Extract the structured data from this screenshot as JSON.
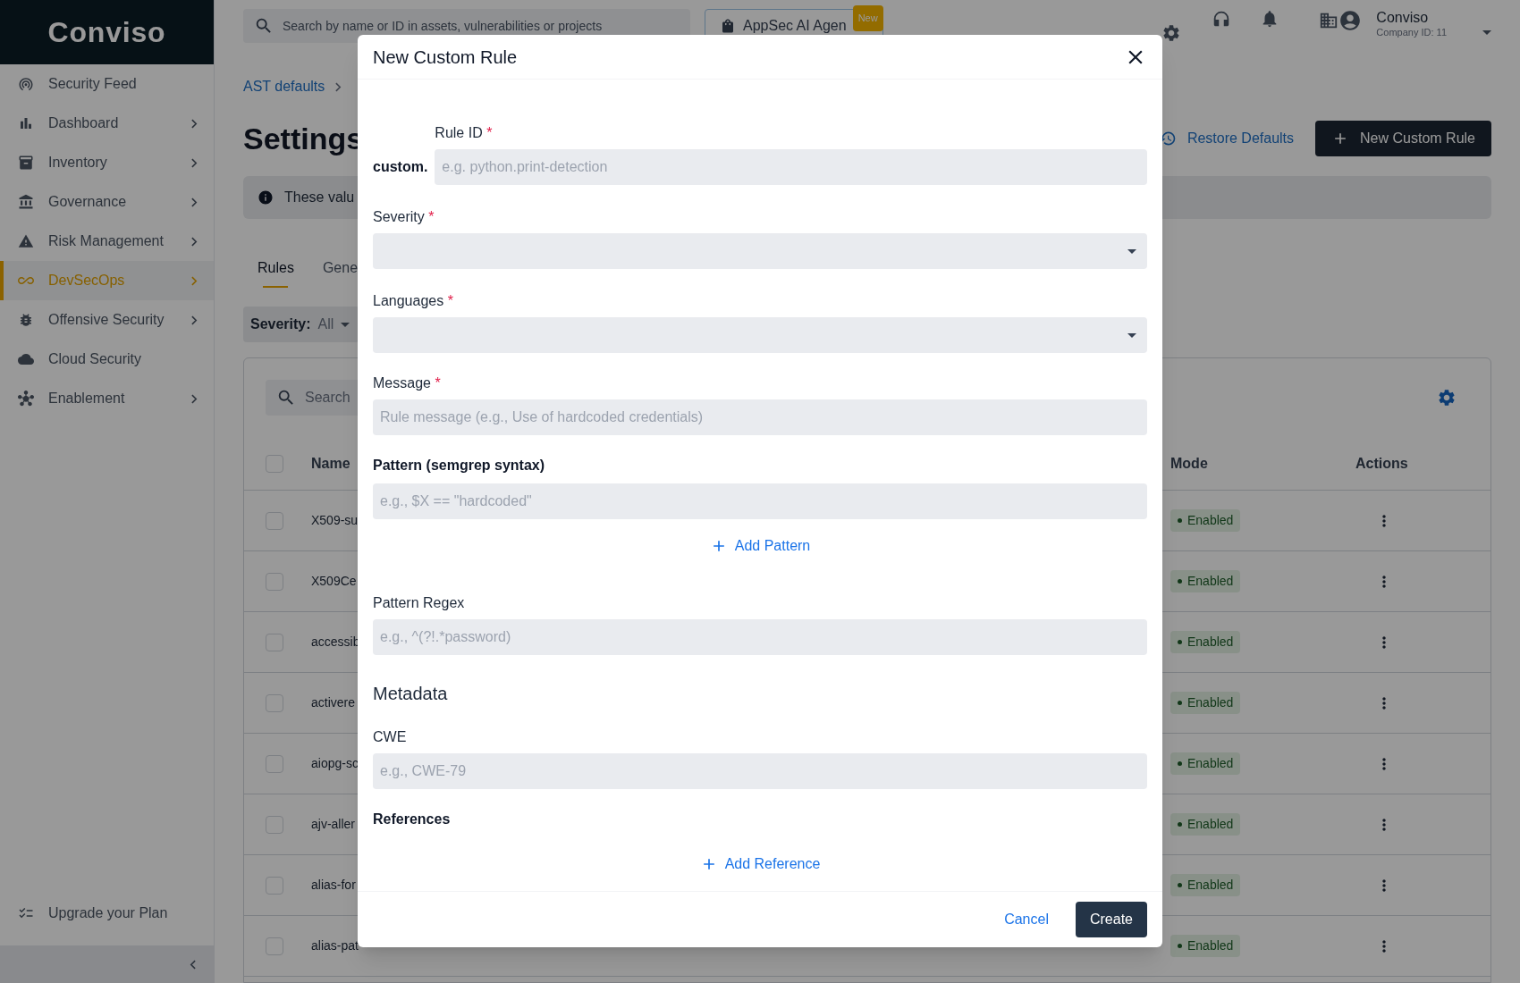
{
  "sidebar": {
    "logo": "Conviso",
    "items": [
      {
        "label": "Security Feed",
        "has_children": false,
        "selected": false
      },
      {
        "label": "Dashboard",
        "has_children": true,
        "selected": false
      },
      {
        "label": "Inventory",
        "has_children": true,
        "selected": false
      },
      {
        "label": "Governance",
        "has_children": true,
        "selected": false
      },
      {
        "label": "Risk Management",
        "has_children": true,
        "selected": false
      },
      {
        "label": "DevSecOps",
        "has_children": true,
        "selected": true
      },
      {
        "label": "Offensive Security",
        "has_children": true,
        "selected": false
      },
      {
        "label": "Cloud Security",
        "has_children": false,
        "selected": false
      },
      {
        "label": "Enablement",
        "has_children": true,
        "selected": false
      }
    ],
    "footer": "Upgrade your Plan"
  },
  "topbar": {
    "search_placeholder": "Search by name or ID in assets, vulnerabilities or projects",
    "agent_button": "AppSec AI Agen",
    "agent_badge": "New",
    "user_name": "Conviso",
    "company": "Company ID: 11"
  },
  "breadcrumb": "AST defaults",
  "page": {
    "title": "Settings",
    "restore": "Restore Defaults",
    "new_rule": "New Custom Rule",
    "banner": "These valu"
  },
  "tabs": [
    {
      "label": "Rules",
      "selected": true
    },
    {
      "label": "Gene",
      "selected": false
    }
  ],
  "filter": {
    "label": "Severity:",
    "value": "All"
  },
  "table": {
    "search_placeholder": "Search",
    "all_checked": false,
    "columns": [
      "Name",
      "Mode",
      "Actions"
    ],
    "rows": [
      {
        "name": "X509-su",
        "mode": "Enabled",
        "checked": false
      },
      {
        "name": "X509Ce",
        "mode": "Enabled",
        "checked": false
      },
      {
        "name": "accessib",
        "mode": "Enabled",
        "checked": false
      },
      {
        "name": "activere",
        "mode": "Enabled",
        "checked": false
      },
      {
        "name": "aiopg-sc",
        "mode": "Enabled",
        "checked": false
      },
      {
        "name": "ajv-aller",
        "mode": "Enabled",
        "checked": false
      },
      {
        "name": "alias-for",
        "mode": "Enabled",
        "checked": false
      },
      {
        "name": "alias-pat",
        "mode": "Enabled",
        "checked": false
      }
    ]
  },
  "modal": {
    "title": "New Custom Rule",
    "items": [
      {
        "kind": "prefixed",
        "prefix": "custom.",
        "label": "Rule ID",
        "mark": "*",
        "placeholder": "e.g. python.print-detection"
      },
      {
        "kind": "select",
        "label": "Severity",
        "mark": "*"
      },
      {
        "kind": "select",
        "label": "Languages",
        "mark": "*"
      },
      {
        "kind": "text",
        "label": "Message",
        "mark": "*",
        "placeholder": "Rule message (e.g., Use of hardcoded credentials)"
      },
      {
        "kind": "heading",
        "label": "Pattern (semgrep syntax)"
      },
      {
        "kind": "input",
        "placeholder": "e.g., $X == \"hardcoded\""
      },
      {
        "kind": "add",
        "label": "Add Pattern"
      },
      {
        "kind": "text",
        "label": "Pattern Regex",
        "placeholder": "e.g., ^(?!.*password)"
      },
      {
        "kind": "section",
        "label": "Metadata"
      },
      {
        "kind": "text",
        "label": "CWE",
        "placeholder": "e.g., CWE-79"
      },
      {
        "kind": "heading",
        "label": "References"
      },
      {
        "kind": "add",
        "label": "Add Reference"
      }
    ],
    "cancel": "Cancel",
    "create": "Create"
  }
}
